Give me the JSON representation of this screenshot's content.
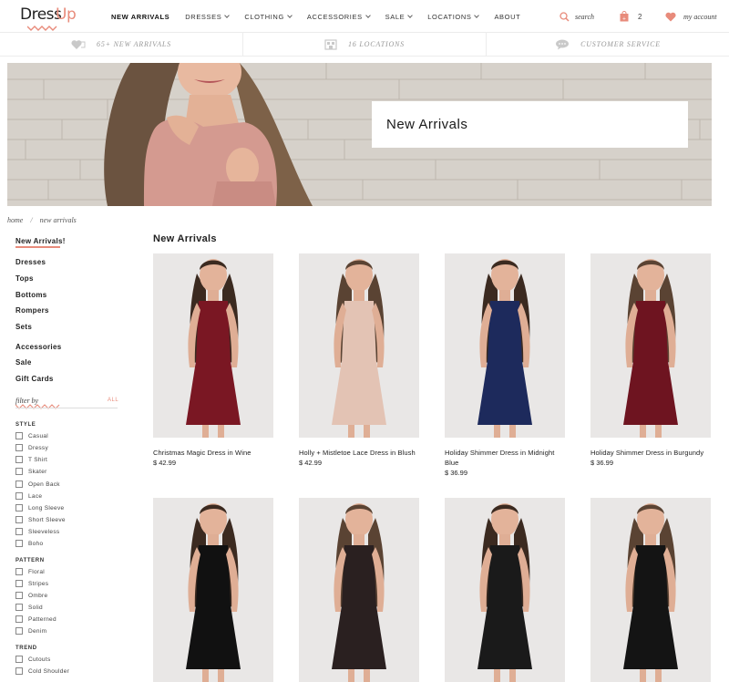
{
  "brand": {
    "logo_part1": "Dress",
    "logo_part2": "Up",
    "accent_color": "#e88b7b"
  },
  "nav": {
    "items": [
      {
        "label": "NEW ARRIVALS",
        "active": true,
        "dropdown": false
      },
      {
        "label": "DRESSES",
        "active": false,
        "dropdown": true
      },
      {
        "label": "CLOTHING",
        "active": false,
        "dropdown": true
      },
      {
        "label": "ACCESSORIES",
        "active": false,
        "dropdown": true
      },
      {
        "label": "SALE",
        "active": false,
        "dropdown": true
      },
      {
        "label": "LOCATIONS",
        "active": false,
        "dropdown": true
      },
      {
        "label": "ABOUT",
        "active": false,
        "dropdown": false
      }
    ],
    "search_label": "search",
    "cart_count": "2",
    "account_label": "my account"
  },
  "promo": [
    {
      "icon": "heart-tag-icon",
      "text": "65+ NEW ARRIVALS"
    },
    {
      "icon": "store-icon",
      "text": "16 LOCATIONS"
    },
    {
      "icon": "chat-bubble-icon",
      "text": "CUSTOMER SERVICE"
    }
  ],
  "hero": {
    "title": "New Arrivals"
  },
  "breadcrumb": {
    "home": "home",
    "separator": "/",
    "current": "new arrivals"
  },
  "sidebar": {
    "categories": [
      "New Arrivals!",
      "Dresses",
      "Tops",
      "Bottoms",
      "Rompers",
      "Sets",
      "Accessories",
      "Sale",
      "Gift Cards"
    ],
    "filter_label": "filter by",
    "filter_all": "ALL",
    "groups": {
      "style": {
        "title": "STYLE",
        "options": [
          "Casual",
          "Dressy",
          "T Shirt",
          "Skater",
          "Open Back",
          "Lace",
          "Long Sleeve",
          "Short Sleeve",
          "Sleeveless",
          "Boho"
        ]
      },
      "pattern": {
        "title": "PATTERN",
        "options": [
          "Floral",
          "Stripes",
          "Ombre",
          "Solid",
          "Patterned",
          "Denim"
        ]
      },
      "trend": {
        "title": "TREND",
        "options": [
          "Cutouts",
          "Cold Shoulder"
        ]
      }
    }
  },
  "products": {
    "title": "New Arrivals",
    "items": [
      {
        "name": "Christmas Magic Dress in Wine",
        "price": "$ 42.99",
        "dress_color": "#7a1723"
      },
      {
        "name": "Holly + Mistletoe Lace Dress in Blush",
        "price": "$ 42.99",
        "dress_color": "#e3c3b4"
      },
      {
        "name": "Holiday Shimmer Dress in Midnight Blue",
        "price": "$ 36.99",
        "dress_color": "#1d2a5c"
      },
      {
        "name": "Holiday Shimmer Dress in Burgundy",
        "price": "$ 36.99",
        "dress_color": "#6e1420"
      },
      {
        "name": "",
        "price": "",
        "dress_color": "#111111"
      },
      {
        "name": "",
        "price": "",
        "dress_color": "#2a2020"
      },
      {
        "name": "",
        "price": "",
        "dress_color": "#1a1a1a"
      },
      {
        "name": "",
        "price": "",
        "dress_color": "#141414"
      }
    ]
  }
}
